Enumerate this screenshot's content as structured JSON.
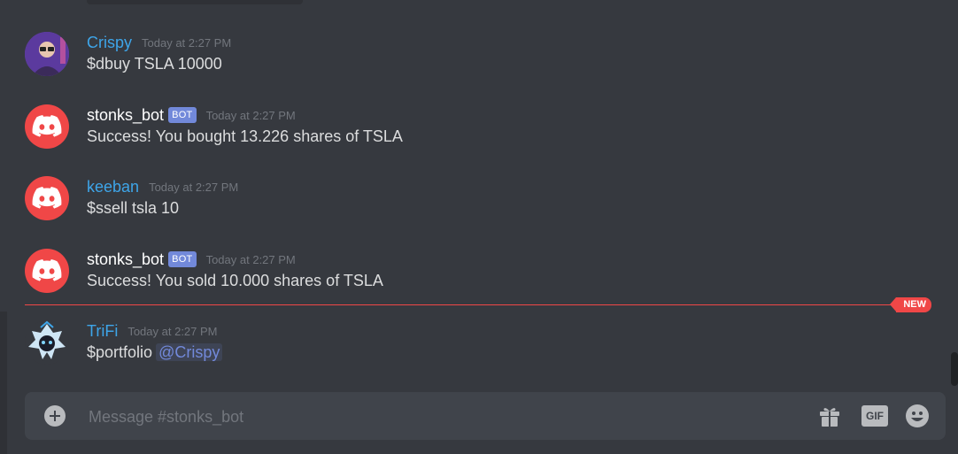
{
  "colors": {
    "background": "#36393f",
    "accent": "#7289da",
    "new_divider": "#f04747",
    "username_blue": "#3ea5e9"
  },
  "messages": [
    {
      "username": "Crispy",
      "timestamp": "Today at 2:27 PM",
      "content": "$dbuy TSLA 10000",
      "avatar_icon": "user-avatar"
    },
    {
      "username": "stonks_bot",
      "bot_tag": "BOT",
      "timestamp": "Today at 2:27 PM",
      "content": "Success! You bought 13.226 shares of TSLA",
      "avatar_icon": "discord-logo-icon"
    },
    {
      "username": "keeban",
      "timestamp": "Today at 2:27 PM",
      "content": "$ssell tsla 10",
      "avatar_icon": "discord-logo-icon"
    },
    {
      "username": "stonks_bot",
      "bot_tag": "BOT",
      "timestamp": "Today at 2:27 PM",
      "content": "Success! You sold 10.000 shares of TSLA",
      "avatar_icon": "discord-logo-icon"
    },
    {
      "username": "TriFi",
      "timestamp": "Today at 2:27 PM",
      "content": "$portfolio",
      "mention": "@Crispy",
      "avatar_icon": "user-avatar"
    }
  ],
  "divider": {
    "label": "NEW"
  },
  "composer": {
    "placeholder": "Message #stonks_bot",
    "gif_label": "GIF",
    "icons": [
      "add-attachment-icon",
      "gift-icon",
      "gif-icon",
      "emoji-icon"
    ]
  }
}
